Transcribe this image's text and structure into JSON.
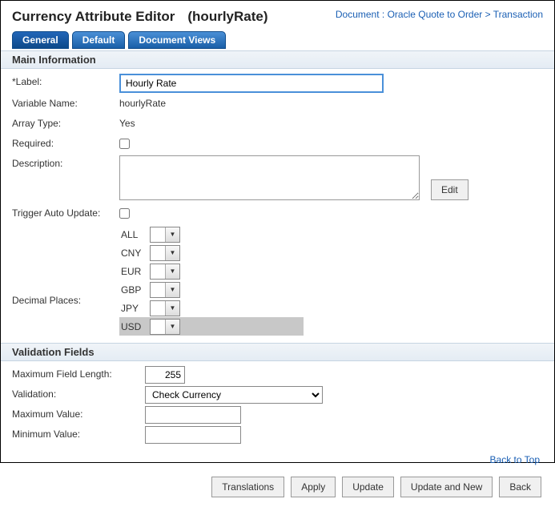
{
  "header": {
    "title": "Currency Attribute Editor",
    "subtitle": "(hourlyRate)",
    "breadcrumb_prefix": "Document : ",
    "breadcrumb_link1": "Oracle Quote to Order",
    "breadcrumb_sep": " > ",
    "breadcrumb_link2": "Transaction"
  },
  "tabs": {
    "general": "General",
    "default": "Default",
    "document_views": "Document Views"
  },
  "sections": {
    "main_info": "Main Information",
    "validation": "Validation Fields"
  },
  "main": {
    "label_lbl": "*Label:",
    "label_value": "Hourly Rate",
    "variable_name_lbl": "Variable Name:",
    "variable_name_value": "hourlyRate",
    "array_type_lbl": "Array Type:",
    "array_type_value": "Yes",
    "required_lbl": "Required:",
    "description_lbl": "Description:",
    "description_value": "",
    "edit_btn": "Edit",
    "trigger_lbl": "Trigger Auto Update:",
    "decimal_lbl": "Decimal Places:",
    "currencies": [
      {
        "code": "ALL",
        "selected": false
      },
      {
        "code": "CNY",
        "selected": false
      },
      {
        "code": "EUR",
        "selected": false
      },
      {
        "code": "GBP",
        "selected": false
      },
      {
        "code": "JPY",
        "selected": false
      },
      {
        "code": "USD",
        "selected": true
      }
    ]
  },
  "validation": {
    "max_field_len_lbl": "Maximum Field Length:",
    "max_field_len_value": "255",
    "validation_lbl": "Validation:",
    "validation_value": "Check Currency",
    "max_value_lbl": "Maximum Value:",
    "max_value_value": "",
    "min_value_lbl": "Minimum Value:",
    "min_value_value": ""
  },
  "footer": {
    "back_to_top": "Back to Top",
    "translations": "Translations",
    "apply": "Apply",
    "update": "Update",
    "update_and_new": "Update and New",
    "back": "Back"
  }
}
